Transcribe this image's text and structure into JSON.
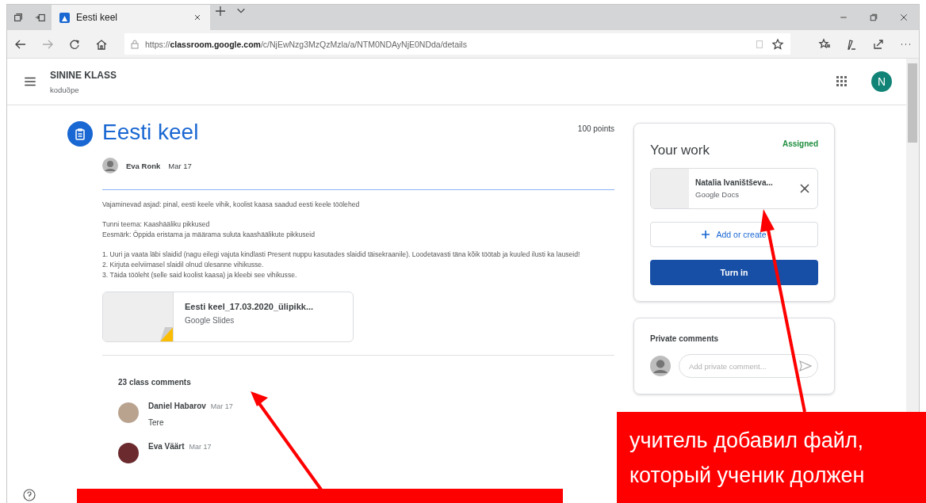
{
  "browser": {
    "tab": {
      "title": "Eesti keel",
      "selected": true
    },
    "url": {
      "scheme": "https://",
      "host": "classroom.google.com",
      "path": "/c/NjEwNzg3MzQzMzla/a/NTM0NDAyNjE0NDda/details"
    }
  },
  "header": {
    "class_name": "SININE KLASS",
    "section": "koduõpe",
    "avatar": "N"
  },
  "assignment": {
    "title": "Eesti keel",
    "points": "100 points",
    "author": "Eva Ronk",
    "date": "Mar 17",
    "paragraphs": [
      [
        "Vajaminevad asjad: pinal, eesti keele vihik, koolist kaasa saadud eesti keele töölehed"
      ],
      [
        "Tunni teema: Kaashääliku pikkused",
        "Eesmärk: Õppida eristama ja määrama suluta kaashäälikute pikkuseid"
      ],
      [
        "1. Uuri ja vaata läbi slaidid (nagu eilegi vajuta kindlasti Present nuppu kasutades slaidid täisekraanile). Loodetavasti täna kõik töötab ja kuuled ilusti ka lauseid!",
        "2. Kirjuta eelviimasel slaidil olnud ülesanne vihikusse.",
        "3. Täida tööleht (selle said koolist kaasa) ja kleebi see vihikusse."
      ]
    ],
    "attachment": {
      "title": "Eesti keel_17.03.2020_ülipikk...",
      "type": "Google Slides"
    }
  },
  "comments": {
    "count": "23 class comments",
    "items": [
      {
        "name": "Daniel Habarov",
        "date": "Mar 17",
        "text": "Tere"
      },
      {
        "name": "Eva Väärt",
        "date": "Mar 17"
      }
    ]
  },
  "your_work": {
    "title": "Your work",
    "status": "Assigned",
    "file": {
      "name": "Natalia Ivaništševa...",
      "type": "Google Docs"
    },
    "add_button": "Add or create",
    "turn_in_button": "Turn in"
  },
  "private_comments": {
    "title": "Private comments",
    "placeholder": "Add private comment..."
  },
  "annotation": {
    "lines": [
      "учитель добавил файл,",
      "который ученик должен"
    ]
  }
}
